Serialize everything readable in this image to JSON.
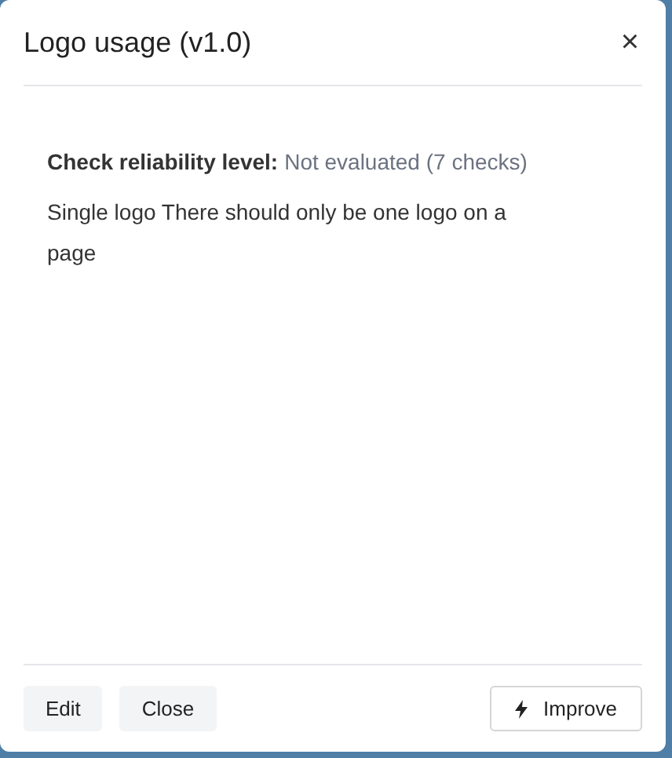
{
  "dialog": {
    "title": "Logo usage (v1.0)",
    "close_icon": "×",
    "reliability": {
      "label": "Check reliability level:",
      "value": "Not evaluated (7 checks)"
    },
    "description": "Single logo There should only be one logo on a page",
    "buttons": [
      {
        "label": "Edit",
        "kind": "secondary"
      },
      {
        "label": "Close",
        "kind": "secondary"
      },
      {
        "label": "Improve",
        "kind": "outline"
      }
    ]
  }
}
